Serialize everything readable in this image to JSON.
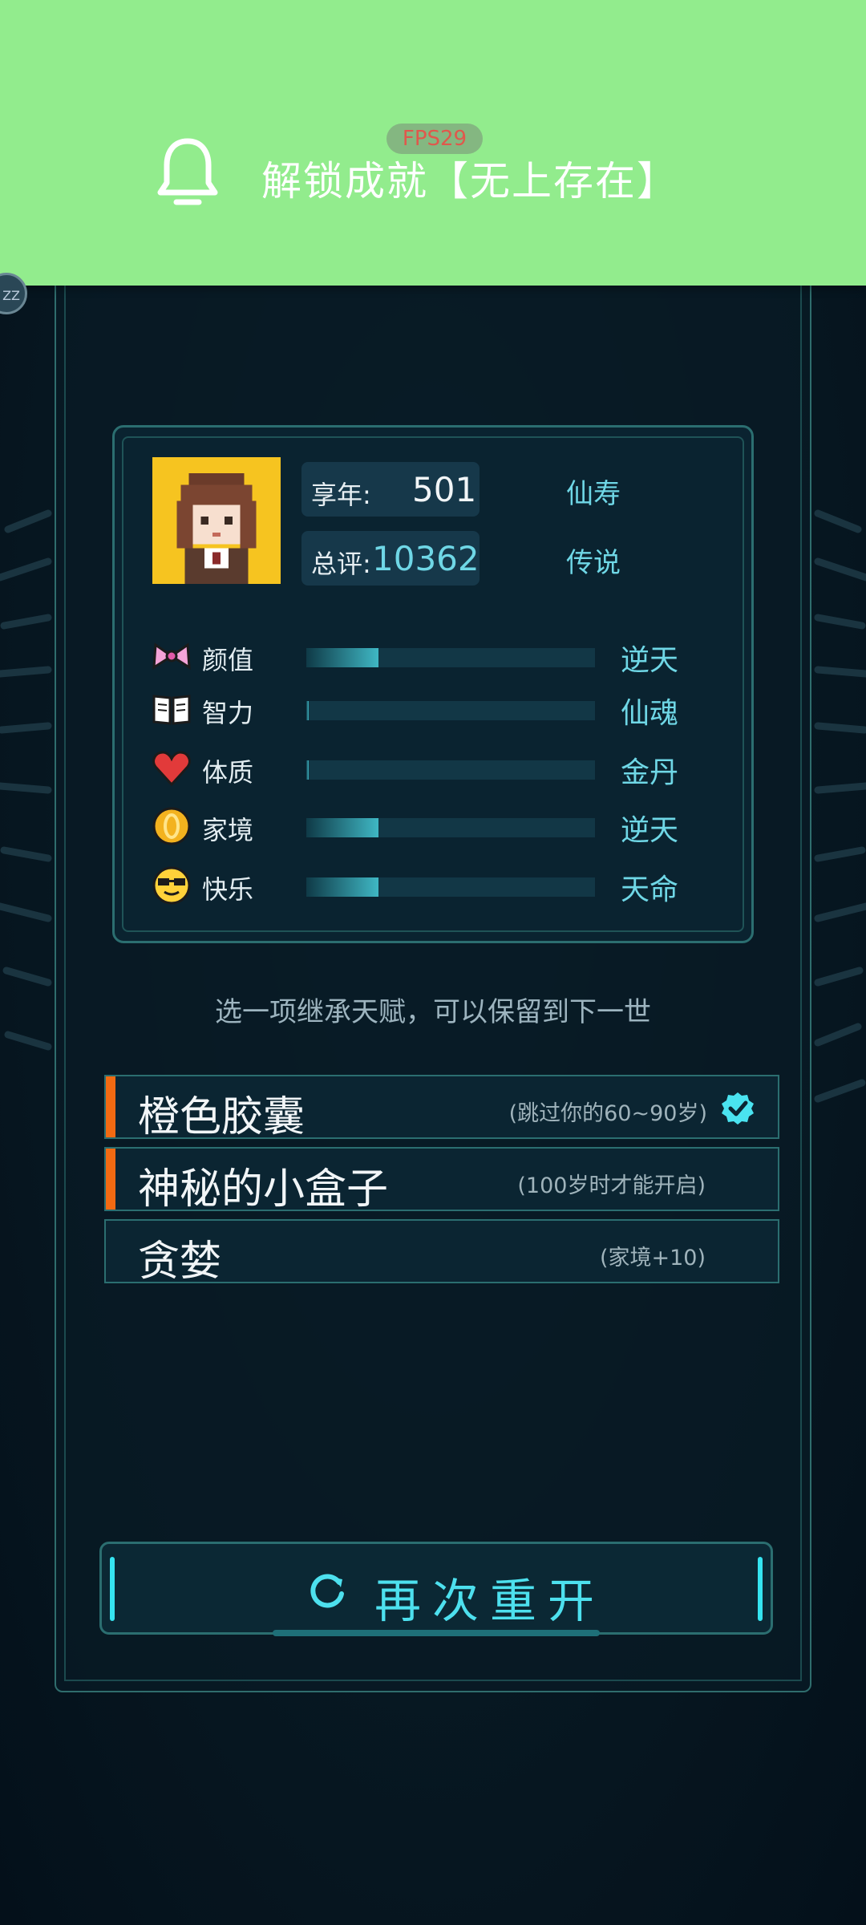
{
  "notification": {
    "title": "解锁成就【无上存在】",
    "fps_badge": "FPS29",
    "side_dot": "ZZ",
    "bell_icon": "bell-icon"
  },
  "summary": {
    "age_label": "享年:",
    "age_value": "501",
    "age_grade": "仙寿",
    "score_label": "总评:",
    "score_value": "10362",
    "score_grade": "传说"
  },
  "attributes": [
    {
      "name": "颜值",
      "icon": "bow-icon",
      "level": "逆天",
      "fill": 0.25
    },
    {
      "name": "智力",
      "icon": "book-icon",
      "level": "仙魂",
      "fill": 0.0
    },
    {
      "name": "体质",
      "icon": "heart-icon",
      "level": "金丹",
      "fill": 0.0
    },
    {
      "name": "家境",
      "icon": "coin-icon",
      "level": "逆天",
      "fill": 0.25
    },
    {
      "name": "快乐",
      "icon": "cool-face-icon",
      "level": "天命",
      "fill": 0.25
    }
  ],
  "inherit_hint": "选一项继承天赋，可以保留到下一世",
  "talents": [
    {
      "title": "橙色胶囊",
      "desc": "(跳过你的60~90岁)",
      "selected": true
    },
    {
      "title": "神秘的小盒子",
      "desc": "(100岁时才能开启)",
      "selected": false
    },
    {
      "title": "贪婪",
      "desc": "(家境+10)",
      "selected": false
    }
  ],
  "restart_button": "再次重开",
  "colors": {
    "accent": "#4de0ee",
    "banner": "#92ec8d",
    "highlight": "#f26a12",
    "frame": "#2b6e70"
  }
}
